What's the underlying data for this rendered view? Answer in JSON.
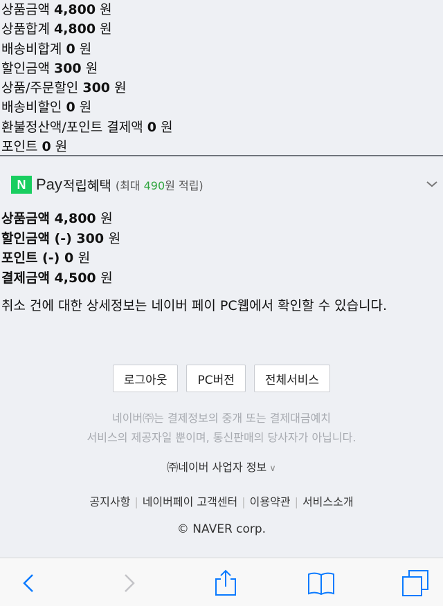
{
  "summary": {
    "rows": [
      {
        "label": "상품금액",
        "value": "4,800",
        "unit": "원"
      },
      {
        "label": "상품합계",
        "value": "4,800",
        "unit": "원"
      },
      {
        "label": "배송비합계",
        "value": "0",
        "unit": "원"
      },
      {
        "label": "할인금액",
        "value": "300",
        "unit": "원"
      },
      {
        "label": "상품/주문할인",
        "value": "300",
        "unit": "원"
      },
      {
        "label": "배송비할인",
        "value": "0",
        "unit": "원"
      },
      {
        "label": "환불정산액/포인트 결제액",
        "value": "0",
        "unit": "원"
      },
      {
        "label": "포인트",
        "value": "0",
        "unit": "원"
      }
    ]
  },
  "naverpay": {
    "logo_letter": "N",
    "logo_word": "Pay",
    "title": "적립혜택",
    "sub_prefix": "(최대 ",
    "sub_amount": "490",
    "sub_suffix": "원 적립)",
    "rows": [
      {
        "label": "상품금액",
        "value": "4,800",
        "unit": "원"
      },
      {
        "label": "할인금액 (-)",
        "value": "300",
        "unit": "원"
      },
      {
        "label": "포인트 (-)",
        "value": "0",
        "unit": "원"
      },
      {
        "label": "결제금액",
        "value": "4,500",
        "unit": "원"
      }
    ],
    "notice": "취소 건에 대한 상세정보는 네이버 페이 PC웹에서 확인할 수 있습니다."
  },
  "footer": {
    "buttons": {
      "logout": "로그아웃",
      "pc": "PC버전",
      "all": "전체서비스"
    },
    "disclaimer_line1": "네이버㈜는 결제정보의 중개 또는 결제대금예치",
    "disclaimer_line2": "서비스의 제공자일 뿐이며, 통신판매의 당사자가 아닙니다.",
    "biz_info": "㈜네이버 사업자 정보",
    "links": {
      "notice": "공지사항",
      "center": "네이버페이 고객센터",
      "terms": "이용약관",
      "intro": "서비스소개"
    },
    "copyright": "© NAVER corp."
  },
  "colors": {
    "naver_green": "#19ce60",
    "accent_green": "#30a53f",
    "ios_blue": "#0a7aff"
  },
  "toolbar": {
    "icons": [
      "back-arrow-icon",
      "forward-arrow-icon",
      "share-icon",
      "bookmarks-icon",
      "tabs-icon"
    ]
  }
}
